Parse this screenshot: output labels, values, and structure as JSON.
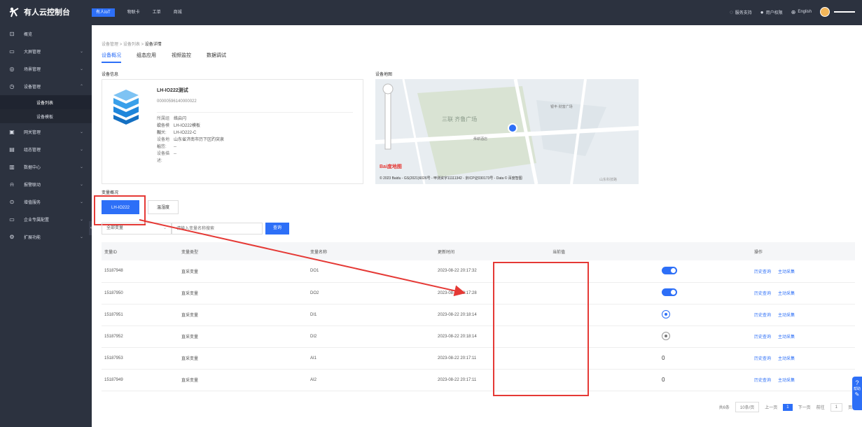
{
  "app": {
    "title": "有人云控制台"
  },
  "nav": {
    "tabs": [
      "有人IoT",
      "物联卡",
      "工单",
      "商城"
    ]
  },
  "topright": {
    "support": "服务支持",
    "permission": "用户权限",
    "language": "English"
  },
  "sidebar": {
    "items": [
      {
        "label": "概览"
      },
      {
        "label": "大屏管理"
      },
      {
        "label": "场景管理"
      },
      {
        "label": "设备管理"
      },
      {
        "label": "设备列表"
      },
      {
        "label": "设备模板"
      },
      {
        "label": "网关管理"
      },
      {
        "label": "组态管理"
      },
      {
        "label": "数据中心"
      },
      {
        "label": "报警联动"
      },
      {
        "label": "增值服务"
      },
      {
        "label": "企业专属配置"
      },
      {
        "label": "扩展功能"
      }
    ]
  },
  "breadcrumb": {
    "a": "设备管理",
    "b": "设备列表",
    "c": "设备详情",
    "sep": ">"
  },
  "detail_tabs": [
    "设备概况",
    "组态应用",
    "视频监控",
    "数据调试"
  ],
  "info": {
    "section": "设备信息",
    "name": "LH-IO222测试",
    "sn": "00000596140000022",
    "fields": [
      {
        "k": "所属组织:",
        "v": "络启闪"
      },
      {
        "k": "设备模板:",
        "v": "LH-IO222模板"
      },
      {
        "k": "网关:",
        "v": "LH-IO222-C"
      },
      {
        "k": "设备地址:",
        "v": "山东省济南市历下区趵突泉"
      },
      {
        "k": "标签:",
        "v": "--"
      },
      {
        "k": "设备描述:",
        "v": "--"
      }
    ]
  },
  "map": {
    "section": "设备地图",
    "label_square": "三联 齐鲁广场",
    "label_hotel": "舜耕酒店",
    "label_plaza": "银丰·财富广场",
    "label_baidu": "Bai度地图",
    "label_road": "山东科技路",
    "copyright": "© 2023 Baidu - GS(2021)6026号 - 甲测资字11111342 - 京ICP证030173号 - Data © 百度智图"
  },
  "variables": {
    "section": "变量概况",
    "tabs": [
      "LH-IO222",
      "温湿度"
    ],
    "filter_select": "全部变量",
    "search_placeholder": "请输入变量名称搜索",
    "query_button": "查询"
  },
  "table": {
    "headers": [
      "变量ID",
      "变量类型",
      "变量名称",
      "更新时间",
      "当前值",
      "操作"
    ],
    "rows": [
      {
        "id": "15187948",
        "type": "直采变量",
        "name": "DO1",
        "time": "2023-08-22 20:17:32",
        "kind": "toggle",
        "value": "on"
      },
      {
        "id": "15187950",
        "type": "直采变量",
        "name": "DO2",
        "time": "2023-08-22 20:17:28",
        "kind": "toggle",
        "value": "on"
      },
      {
        "id": "15187951",
        "type": "直采变量",
        "name": "DI1",
        "time": "2023-08-22 20:18:14",
        "kind": "radio",
        "value": "on"
      },
      {
        "id": "15187952",
        "type": "直采变量",
        "name": "DI2",
        "time": "2023-08-22 20:18:14",
        "kind": "radio",
        "value": "off"
      },
      {
        "id": "15187953",
        "type": "直采变量",
        "name": "AI1",
        "time": "2023-08-22 20:17:11",
        "kind": "number",
        "value": "0"
      },
      {
        "id": "15187949",
        "type": "直采变量",
        "name": "AI2",
        "time": "2023-08-22 20:17:11",
        "kind": "number",
        "value": "0"
      }
    ],
    "actions": [
      "历史查询",
      "主动采集"
    ]
  },
  "pager": {
    "total": "共6条",
    "size": "10条/页",
    "prev": "上一页",
    "page": "1",
    "next": "下一页",
    "goto": "前往",
    "goto_val": "1",
    "suffix": "页"
  },
  "help": {
    "label": "帮助"
  },
  "colors": {
    "accent": "#2d6ff7",
    "sidebar": "#2c323f",
    "annotation": "#e53935"
  }
}
